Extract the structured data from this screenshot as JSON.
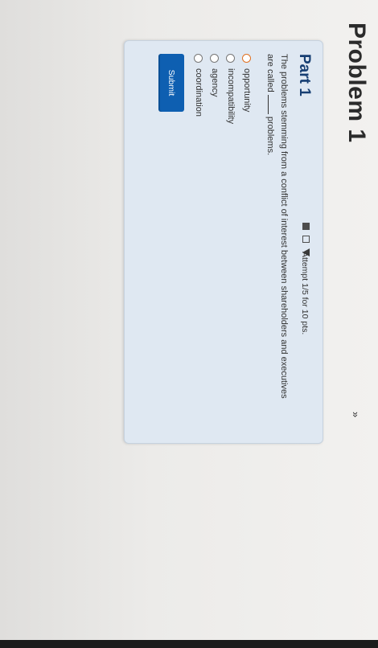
{
  "page": {
    "title": "Problem 1",
    "expand_icon": "»"
  },
  "part": {
    "title": "Part 1",
    "tool_icons": [
      "square-icon",
      "outlined-square-icon",
      "flag-icon"
    ],
    "attempt_text": "Attempt 1/5 for 10 pts."
  },
  "question": {
    "text_before": "The problems stemming from a conflict of interest between shareholders and executives are called",
    "text_after": "problems."
  },
  "options": [
    {
      "label": "opportunity",
      "selected": true
    },
    {
      "label": "incompatibility",
      "selected": false
    },
    {
      "label": "agency",
      "selected": false
    },
    {
      "label": "coordination",
      "selected": false
    }
  ],
  "actions": {
    "submit_label": "Submit"
  },
  "colors": {
    "accent": "#0e5fb1",
    "part_title": "#173f73",
    "card_bg": "#dfe8f2",
    "radio_selected": "#e07020"
  }
}
